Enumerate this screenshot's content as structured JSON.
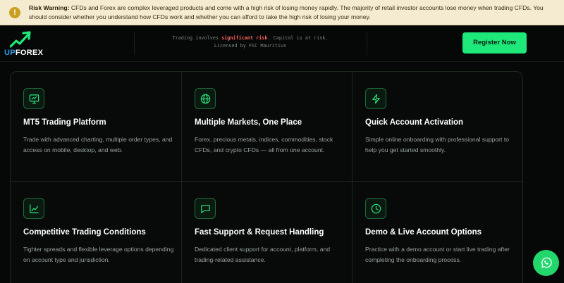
{
  "warning": {
    "label": "Risk Warning:",
    "text": "CFDs and Forex are complex leveraged products and come with a high risk of losing money rapidly. The majority of retail investor accounts lose money when trading CFDs. You should consider whether you understand how CFDs work and whether you can afford to take the high risk of losing your money.",
    "icon": "exclamation-icon"
  },
  "header": {
    "logo": {
      "up": "UP",
      "forex": "FOREX"
    },
    "risk_notice": {
      "prefix": "Trading involves ",
      "highlight": "significant risk",
      "suffix": ". Capital is at risk.",
      "line2": "Licensed by FSC Mauritius"
    },
    "register_label": "Register Now"
  },
  "features": [
    {
      "icon": "monitor-chart-icon",
      "title": "MT5 Trading Platform",
      "desc": "Trade with advanced charting, multiple order types, and access on mobile, desktop, and web."
    },
    {
      "icon": "globe-icon",
      "title": "Multiple Markets, One Place",
      "desc": "Forex, precious metals, indices, commodities, stock CFDs, and crypto CFDs — all from one account."
    },
    {
      "icon": "lightning-icon",
      "title": "Quick Account Activation",
      "desc": "Simple online onboarding with professional support to help you get started smoothly."
    },
    {
      "icon": "line-chart-icon",
      "title": "Competitive Trading Conditions",
      "desc": "Tighter spreads and flexible leverage options depending on account type and jurisdiction."
    },
    {
      "icon": "message-icon",
      "title": "Fast Support & Request Handling",
      "desc": "Dedicated client support for account, platform, and trading-related assistance."
    },
    {
      "icon": "clock-icon",
      "title": "Demo & Live Account Options",
      "desc": "Practice with a demo account or start live trading after completing the onboarding process."
    }
  ],
  "colors": {
    "accent": "#1fe87a",
    "background": "#050806",
    "warning_bg": "#f5ebd1",
    "risk_highlight": "#ff6262",
    "logo_blue": "#2f9df0"
  }
}
